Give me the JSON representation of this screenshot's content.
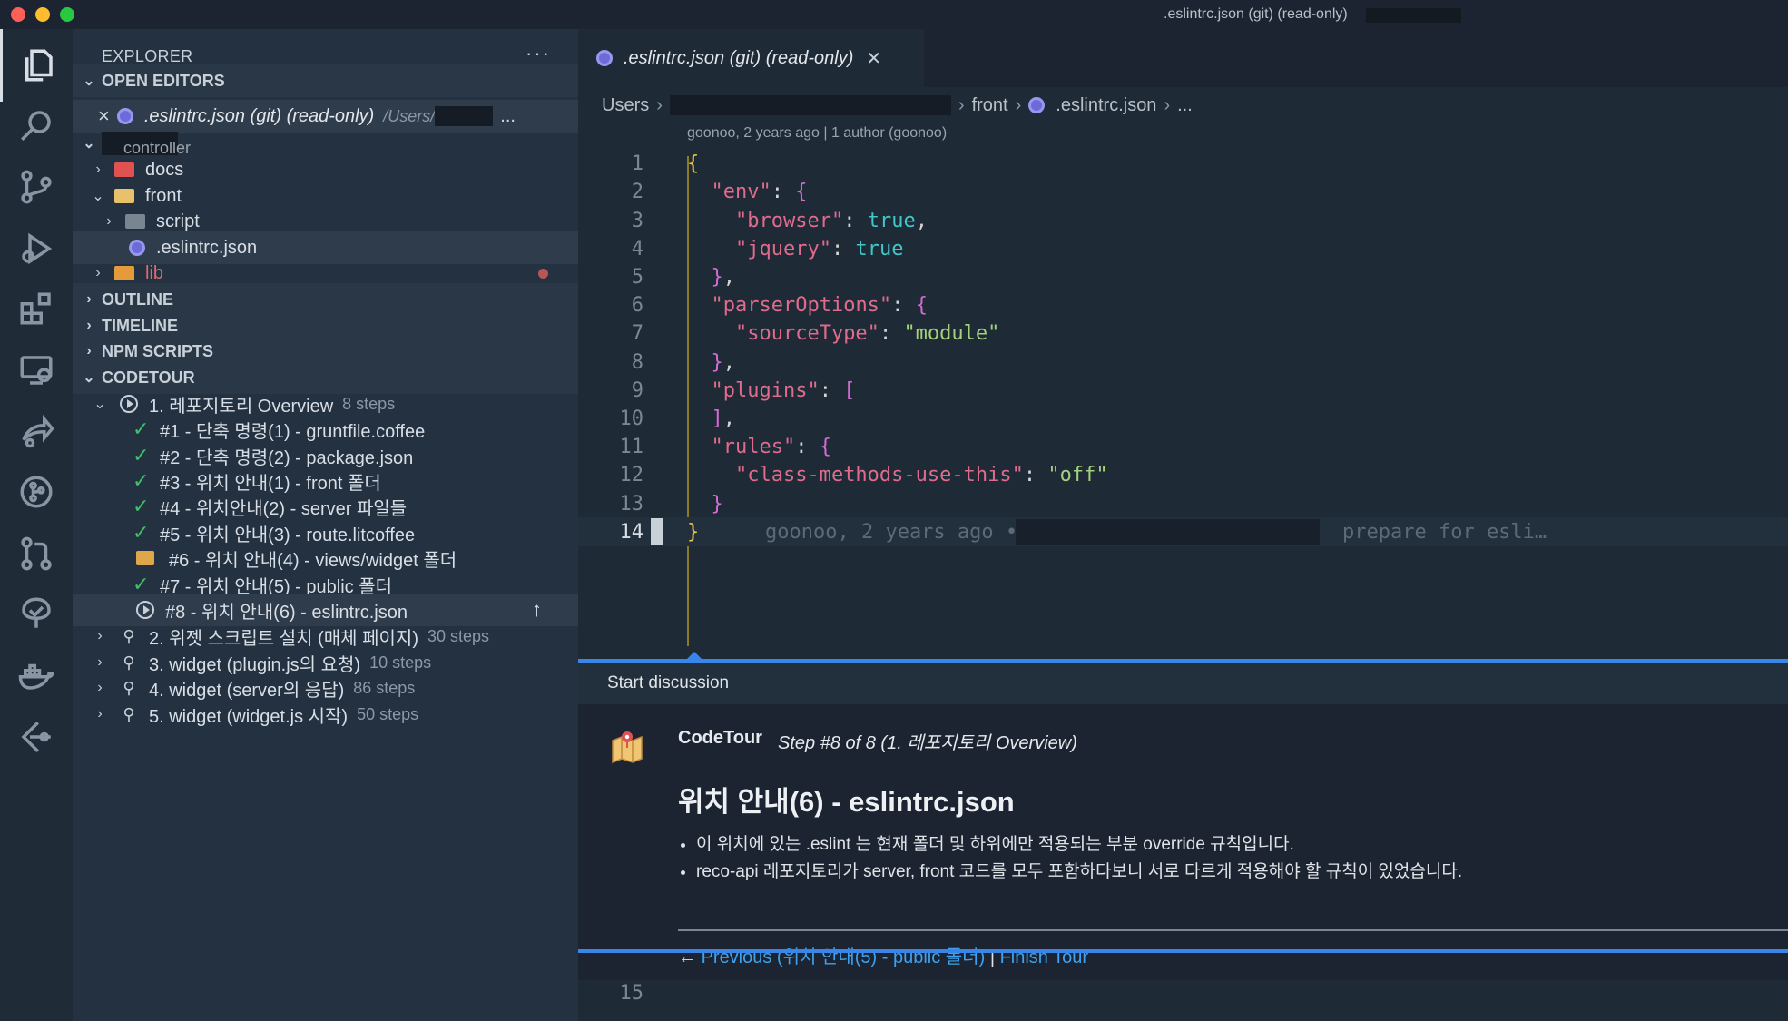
{
  "window": {
    "title": ".eslintrc.json (git) (read-only)"
  },
  "activity_bar": [
    "explorer-icon",
    "search-icon",
    "source-control-icon",
    "run-debug-icon",
    "extensions-icon",
    "remote-explorer-icon",
    "live-share-icon",
    "git-graph-icon",
    "pull-request-icon",
    "codetour-tree-icon",
    "docker-icon",
    "gitlens-icon"
  ],
  "sidebar": {
    "title": "EXPLORER",
    "more": "···",
    "open_editors": {
      "label": "OPEN EDITORS",
      "item": {
        "name": ".eslintrc.json (git) (read-only)",
        "path": "/Users/",
        "ellipsis": "..."
      }
    },
    "tree": {
      "partial": "controller",
      "docs": "docs",
      "front": "front",
      "script": "script",
      "eslintrc": ".eslintrc.json",
      "lib": "lib"
    },
    "sections": {
      "outline": "OUTLINE",
      "timeline": "TIMELINE",
      "npm": "NPM SCRIPTS",
      "codetour": "CODETOUR"
    },
    "tours": [
      {
        "title": "1. 레포지토리 Overview",
        "steps": "8 steps"
      },
      {
        "title": "2. 위젯 스크립트 설치 (매체 페이지)",
        "steps": "30 steps"
      },
      {
        "title": "3. widget (plugin.js의 요청)",
        "steps": "10 steps"
      },
      {
        "title": "4. widget (server의 응답)",
        "steps": "86 steps"
      },
      {
        "title": "5. widget (widget.js 시작)",
        "steps": "50 steps"
      }
    ],
    "tour_steps": [
      "#1 - 단축 명령(1) - gruntfile.coffee",
      "#2 - 단축 명령(2) - package.json",
      "#3 - 위치 안내(1) - front 폴더",
      "#4 - 위치안내(2) - server 파일들",
      "#5 - 위치 안내(3) - route.litcoffee",
      "#6 - 위치 안내(4) - views/widget 폴더",
      "#7 - 위치 안내(5) - public 폴더",
      "#8 - 위치 안내(6) - eslintrc.json"
    ]
  },
  "editor": {
    "tab": ".eslintrc.json (git) (read-only)",
    "breadcrumb": {
      "users": "Users",
      "front": "front",
      "file": ".eslintrc.json",
      "tail": "..."
    },
    "blame_header": "goonoo, 2 years ago | 1 author (goonoo)",
    "line_numbers": [
      "1",
      "2",
      "3",
      "4",
      "5",
      "6",
      "7",
      "8",
      "9",
      "10",
      "11",
      "12",
      "13",
      "14"
    ],
    "inline_blame": {
      "prefix": "goonoo, 2 years ago •",
      "suffix": "prepare for esli…"
    },
    "after_line": "15"
  },
  "codetour": {
    "header": "Start discussion",
    "author": "CodeTour",
    "step": "Step #8 of 8 (1. 레포지토리 Overview)",
    "title": "위치 안내(6) - eslintrc.json",
    "bullets": [
      "이 위치에 있는 .eslint 는 현재 폴더 및 하위에만 적용되는 부분 override 규칙입니다.",
      "reco-api 레포지토리가 server, front 코드를 모두 포함하다보니 서로 다르게 적용해야 할 규칙이 있었습니다."
    ],
    "nav": {
      "arrow": "←",
      "previous": "Previous (위치 안내(5) - public 폴더)",
      "sep": "|",
      "finish": "Finish Tour"
    }
  },
  "colors": {
    "accent": "#3a86e8",
    "check": "#3fbf6a",
    "lib": "#e06b6b"
  }
}
